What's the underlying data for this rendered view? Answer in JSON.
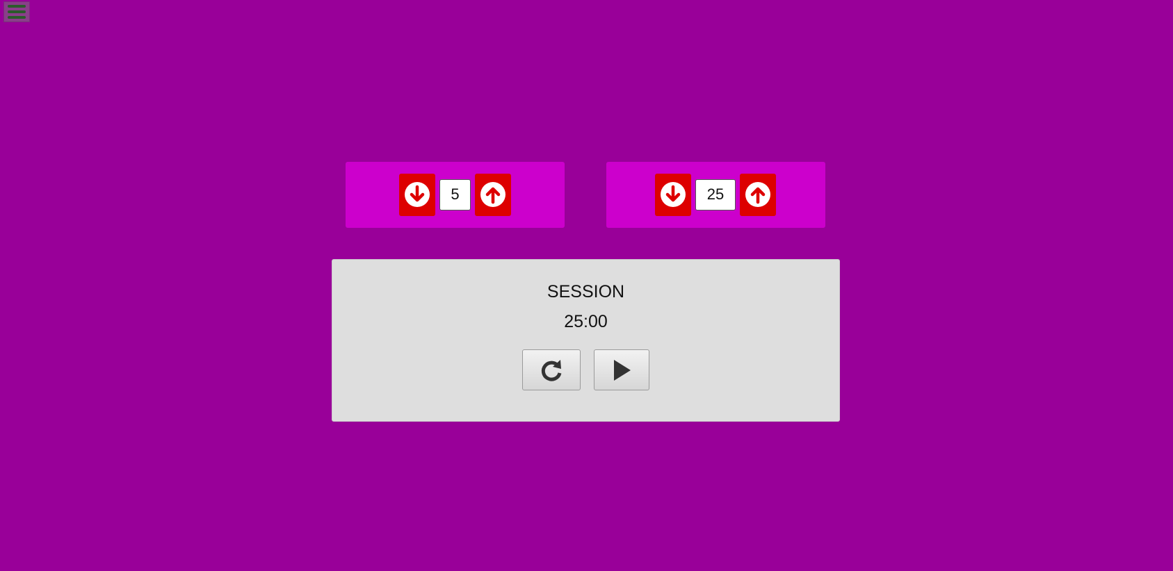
{
  "menu": {
    "icon": "hamburger-icon"
  },
  "break": {
    "value": "5",
    "decrement_icon": "arrow-circle-down-icon",
    "increment_icon": "arrow-circle-up-icon"
  },
  "session": {
    "value": "25",
    "decrement_icon": "arrow-circle-down-icon",
    "increment_icon": "arrow-circle-up-icon"
  },
  "timer": {
    "label": "SESSION",
    "time": "25:00",
    "reset_icon": "refresh-icon",
    "play_icon": "play-icon"
  },
  "colors": {
    "background": "#990099",
    "panel": "#cc00cc",
    "arrow_button": "#dd0000",
    "timer_panel": "#dedede"
  }
}
